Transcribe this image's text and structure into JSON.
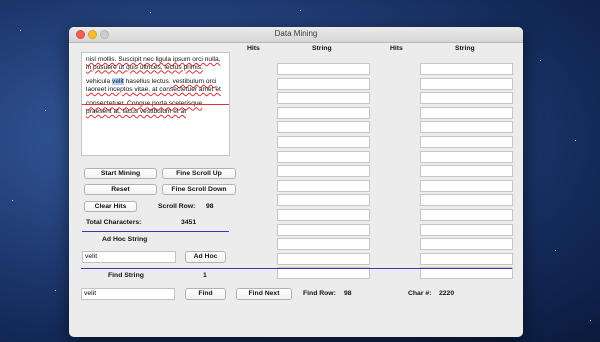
{
  "window": {
    "title": "Data Mining"
  },
  "text_area": {
    "paragraphs": [
      [
        {
          "t": "nisl mollis. Suscipit nec ligula ipsum orci nulla, in posuere ut quis ultrices, lectus primis.",
          "sq": true
        }
      ],
      [
        {
          "t": "vehicula ",
          "sq": false
        },
        {
          "t": "velit",
          "sel": true
        },
        {
          "t": " hasellus lectus.",
          "sq": false
        },
        {
          "t": " vestibulum orci laoreet inceptos vitae, at consectetuer amet et",
          "sq": true
        }
      ],
      [
        {
          "t": "consectetuer. Congue porta scelerisque praesent at, lacus vestibulum et at",
          "sq": true
        }
      ]
    ]
  },
  "buttons": {
    "start_mining": "Start Mining",
    "fine_scroll_up": "Fine Scroll Up",
    "reset": "Reset",
    "fine_scroll_down": "Fine Scroll Down",
    "clear_hits": "Clear Hits",
    "ad_hoc": "Ad Hoc",
    "find": "Find",
    "find_next": "Find Next"
  },
  "labels": {
    "scroll_row": "Scroll Row:",
    "scroll_row_value": "98",
    "total_characters": "Total Characters:",
    "total_characters_value": "3451",
    "ad_hoc_string": "Ad Hoc String",
    "find_string": "Find String",
    "find_string_count": "1",
    "find_row": "Find Row:",
    "find_row_value": "98",
    "char_num": "Char #:",
    "char_num_value": "2220"
  },
  "inputs": {
    "ad_hoc_value": "velit",
    "find_value": "velit"
  },
  "results": {
    "col1_hits_header": "Hits",
    "col1_string_header": "String",
    "col2_hits_header": "Hits",
    "col2_string_header": "String",
    "rows": 15
  },
  "colors": {
    "separator": "#3a3ab8",
    "window_bg": "#ececec"
  }
}
